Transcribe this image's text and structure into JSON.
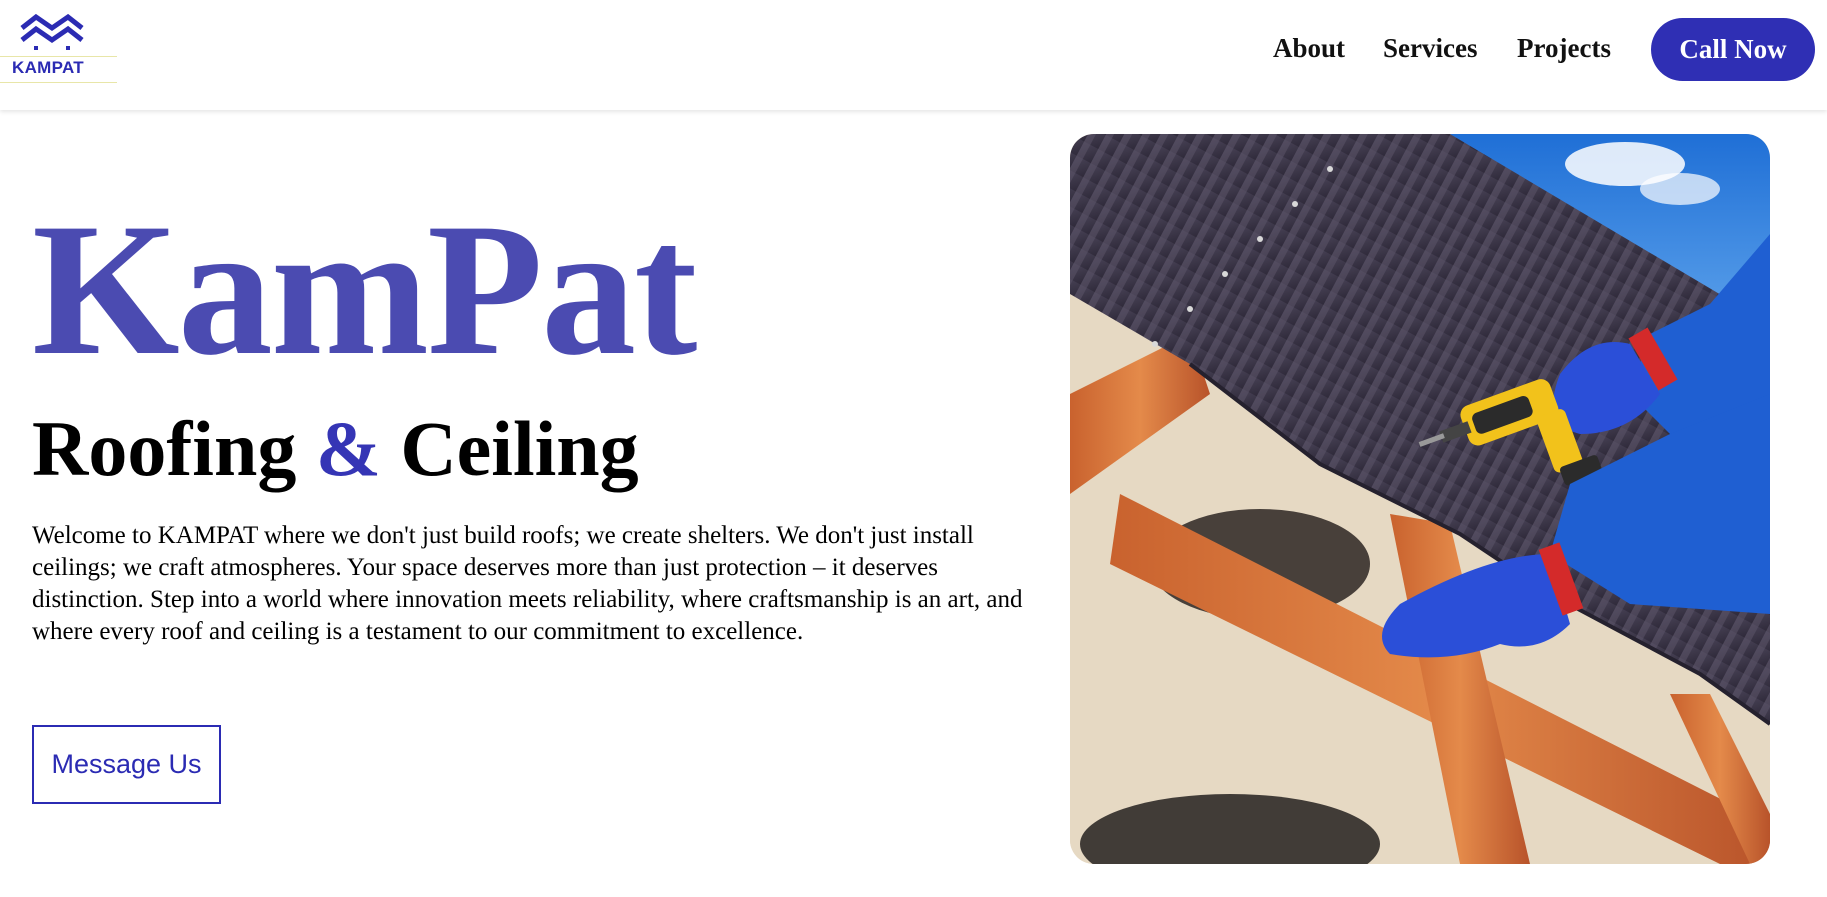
{
  "header": {
    "logo": {
      "text": "KAMPAT",
      "icon": "roof-chevrons-logo-icon",
      "color": "#2b2bb3"
    },
    "nav": [
      {
        "label": "About"
      },
      {
        "label": "Services"
      },
      {
        "label": "Projects"
      }
    ],
    "cta_label": "Call Now"
  },
  "hero": {
    "brand": "KamPat",
    "subtitle": {
      "part1": "Roofing",
      "amp": "&",
      "part2": "Ceiling"
    },
    "intro": "Welcome to KAMPAT where we don't just build roofs; we create shelters. We don't just install ceilings; we craft atmospheres. Your space deserves more than just protection – it deserves distinction. Step into a world where innovation meets reliability, where craftsmanship is an art, and where every roof and ceiling is a testament to our commitment to excellence.",
    "button_label": "Message Us",
    "image": {
      "description_icon": "roofer-drilling-metal-roof-photo"
    }
  },
  "colors": {
    "brand": "#4b4bb1",
    "accent": "#2f2fb4",
    "text": "#000000",
    "background": "#ffffff"
  }
}
